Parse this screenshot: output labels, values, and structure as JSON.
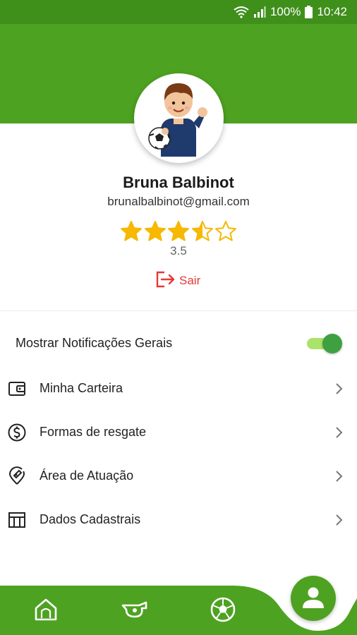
{
  "status_bar": {
    "battery": "100%",
    "time": "10:42",
    "icons": [
      "wifi-icon",
      "signal-icon",
      "battery-icon"
    ]
  },
  "profile": {
    "avatar": "avatar-boy-with-soccer-ball",
    "name": "Bruna Balbinot",
    "email": "brunalbalbinot@gmail.com",
    "rating": 3.5,
    "rating_max": 5,
    "rating_text": "3.5",
    "logout_label": "Sair"
  },
  "settings": {
    "notifications_label": "Mostrar Notificações Gerais",
    "notifications_on": true
  },
  "menu": [
    {
      "label": "Minha Carteira",
      "icon": "wallet-icon"
    },
    {
      "label": "Formas de resgate",
      "icon": "dollar-circle-icon"
    },
    {
      "label": "Área de Atuação",
      "icon": "location-pin-icon"
    },
    {
      "label": "Dados Cadastrais",
      "icon": "table-icon"
    }
  ],
  "bottom_nav": {
    "items": [
      "home-icon",
      "whistle-icon",
      "soccer-ball-icon",
      "profile-icon"
    ],
    "active": "profile-icon"
  },
  "colors": {
    "primary_green": "#4ea221",
    "status_green": "#3f8f1b",
    "star_yellow": "#f6b800",
    "logout_red": "#e53935",
    "toggle_thumb": "#3ea040",
    "toggle_track": "#a9e36a"
  }
}
